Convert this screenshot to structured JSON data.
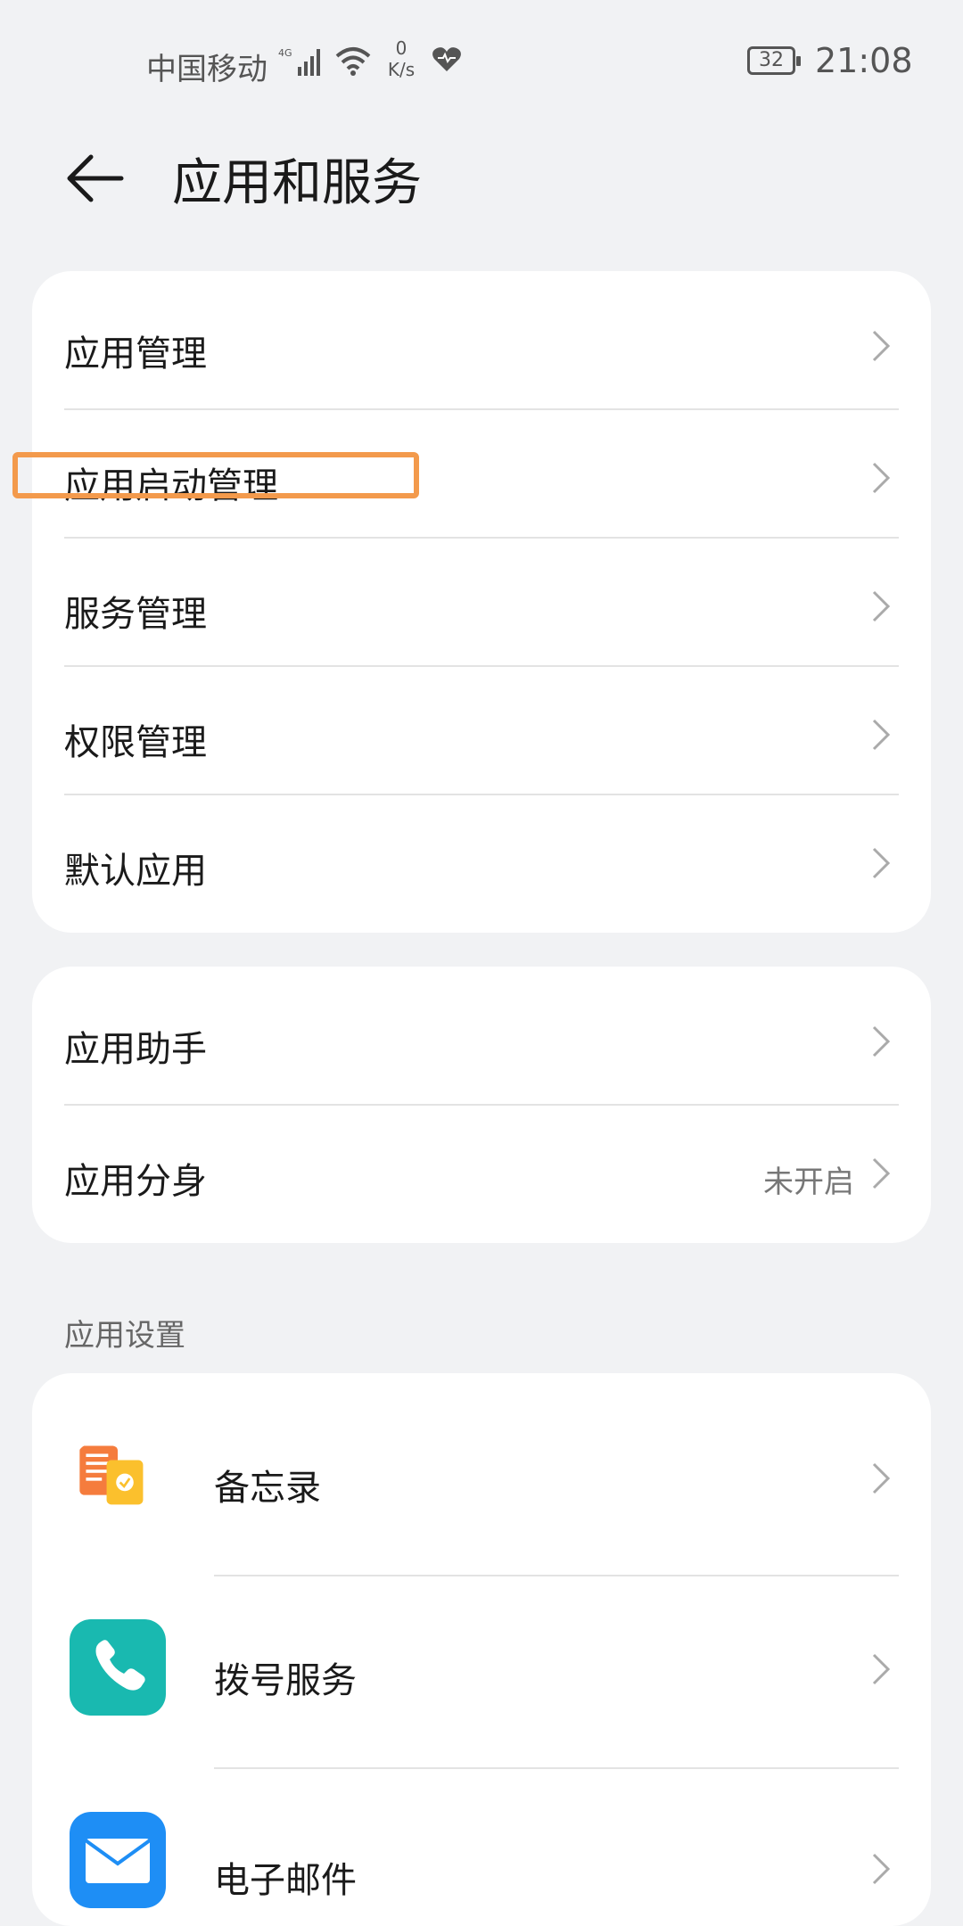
{
  "status_bar": {
    "carrier": "中国移动",
    "network_type": "4G",
    "speed_value": "0",
    "speed_unit": "K/s",
    "battery": "32",
    "time": "21:08"
  },
  "header": {
    "title": "应用和服务"
  },
  "group1": [
    {
      "label": "应用管理"
    },
    {
      "label": "应用启动管理"
    },
    {
      "label": "服务管理"
    },
    {
      "label": "权限管理"
    },
    {
      "label": "默认应用"
    }
  ],
  "group2": [
    {
      "label": "应用助手"
    },
    {
      "label": "应用分身",
      "value": "未开启"
    }
  ],
  "section_app_settings": "应用设置",
  "apps": [
    {
      "label": "备忘录",
      "icon": "memo-icon"
    },
    {
      "label": "拨号服务",
      "icon": "phone-icon"
    },
    {
      "label": "电子邮件",
      "icon": "email-icon"
    }
  ],
  "colors": {
    "background": "#f1f2f4",
    "card": "#ffffff",
    "highlight": "#f39a4c",
    "phone_icon": "#19b9b0",
    "email_icon": "#1e8ef5"
  }
}
